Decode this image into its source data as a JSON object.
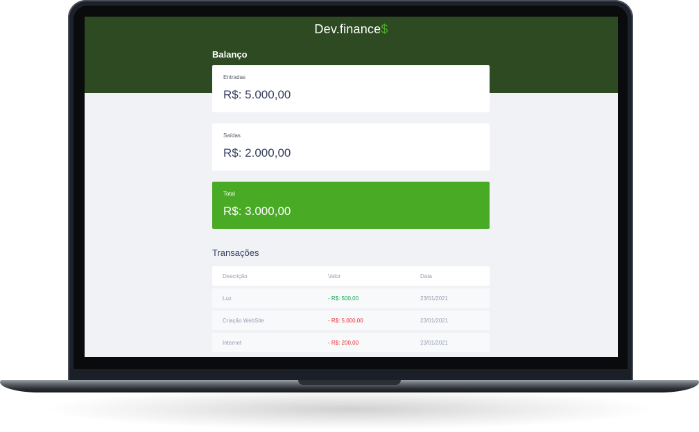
{
  "app": {
    "logo_text": "Dev.finance",
    "logo_sign": "$"
  },
  "balance": {
    "title": "Balanço",
    "cards": [
      {
        "label": "Entradas",
        "value": "R$: 5.000,00"
      },
      {
        "label": "Saídas",
        "value": "R$: 2.000,00"
      },
      {
        "label": "Total",
        "value": "R$: 3.000,00"
      }
    ]
  },
  "transactions": {
    "title": "Transações",
    "headers": [
      "Descrição",
      "Valor",
      "Data"
    ],
    "rows": [
      {
        "description": "Luz",
        "amount": "- R$: 500,00",
        "date": "23/01/2021",
        "type": "income"
      },
      {
        "description": "Criação WebSite",
        "amount": "- R$: 5.000,00",
        "date": "23/01/2021",
        "type": "expense"
      },
      {
        "description": "Internet",
        "amount": "- R$: 200,00",
        "date": "23/01/2021",
        "type": "expense"
      }
    ]
  },
  "colors": {
    "header_bg": "#2d4a22",
    "accent_green": "#49aa26",
    "income": "#12a454",
    "expense": "#e92929",
    "page_bg": "#f0f2f5"
  }
}
